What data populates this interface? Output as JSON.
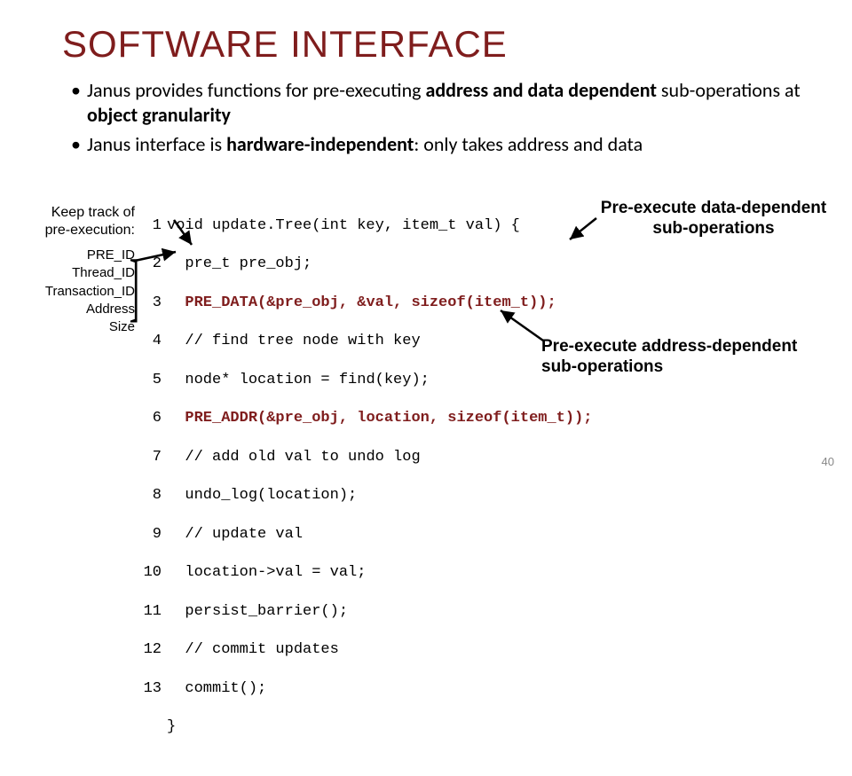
{
  "title": "SOFTWARE INTERFACE",
  "bullets": {
    "b1_pre": "Janus provides functions for pre-executing ",
    "b1_bold1": "address and data dependent",
    "b1_mid": " sub-operations at ",
    "b1_bold2": "object granularity",
    "b2_pre": "Janus interface is ",
    "b2_bold": "hardware-independent",
    "b2_post": ": only takes address and data"
  },
  "left": {
    "l1": "Keep track of",
    "l2": "pre-execution:",
    "s1": "PRE_ID",
    "s2": "Thread_ID",
    "s3": "Transaction_ID",
    "s4": "Address",
    "s5": "Size"
  },
  "code": {
    "r1a": "void update.Tree(int key, item_t val) {",
    "r2": "pre_t pre_obj;",
    "r3": "PRE_DATA(&pre_obj, &val, sizeof(item_t));",
    "r4": "// find tree node with key",
    "r5": "node* location = find(key);",
    "r6": "PRE_ADDR(&pre_obj, location, sizeof(item_t));",
    "r7": "// add old val to undo log",
    "r8": "undo_log(location);",
    "r9": "// update val",
    "r10": "location->val = val;",
    "r11": "persist_barrier();",
    "r12": "// commit updates",
    "r13": "commit();",
    "close": "}"
  },
  "ln": {
    "n1": "1",
    "n2": "2",
    "n3": "3",
    "n4": "4",
    "n5": "5",
    "n6": "6",
    "n7": "7",
    "n8": "8",
    "n9": "9",
    "n10": "10",
    "n11": "11",
    "n12": "12",
    "n13": "13"
  },
  "callouts": {
    "c1a": "Pre-execute data-dependent",
    "c1b": "sub-operations",
    "c2a": "Pre-execute address-dependent",
    "c2b": "sub-operations"
  },
  "pagenum": "40"
}
